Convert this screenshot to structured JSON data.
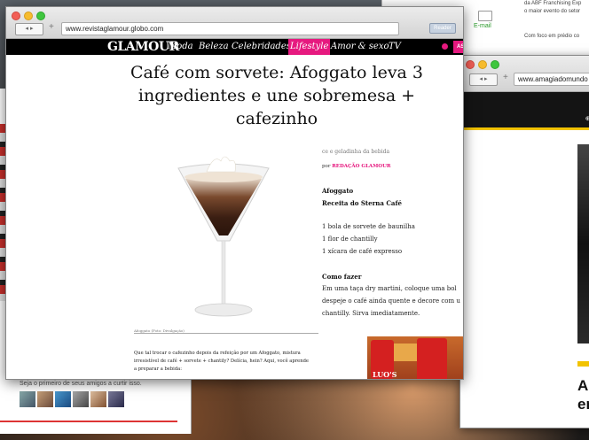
{
  "background_windows": {
    "top_right": {
      "lines": [
        "da ABF Franchising Exp",
        "o maior evento do setor",
        "Com foco em prédio co"
      ],
      "email_label": "E-mail"
    },
    "left": {
      "facebook_text": "Seja o primeiro de seus amigos a curtir isso."
    },
    "right": {
      "url": "www.amagiadomundo",
      "menu_text": "⊕ v",
      "headline_line1": "Ap",
      "headline_line2": "en"
    }
  },
  "main_window": {
    "url": "www.revistaglamour.globo.com",
    "nav_back_forward": "◂ ▸",
    "new_tab": "+",
    "reader_button": "Reader",
    "logo": "GLAMOUR",
    "nav": [
      {
        "label": "Moda",
        "active": false
      },
      {
        "label": "Beleza",
        "active": false
      },
      {
        "label": "Celebridades",
        "active": false
      },
      {
        "label": "Lifestyle",
        "active": true
      },
      {
        "label": "Amor & sexo",
        "active": false
      },
      {
        "label": "TV",
        "active": false
      }
    ],
    "subscribe_label": "ASSINE",
    "accent_color": "#e6197f",
    "article": {
      "title": "Café com sorvete: Afoggato leva 3 ingredientes e une sobremesa + cafezinho",
      "photo_credit": "Afoggato (Foto: Divulgação)",
      "tagline": "ce e geladinha da bebida",
      "byline_prefix": "por",
      "byline_author": "REDAÇÃO GLAMOUR",
      "recipe_name": "Afoggato",
      "recipe_source": "Receita do Sterna Café",
      "ingredients": [
        "1 bola de sorvete de baunilha",
        "1 flor de chantilly",
        "1 xícara de café expresso"
      ],
      "howto_heading": "Como fazer",
      "howto_lines": [
        "Em uma taça dry martini, coloque uma bol",
        "despeje o café ainda quente e decore com u",
        "chantilly. Sirva imediatamente."
      ],
      "intro": "Que tal trocar o cafezinho depois da refeição por um Afoggato, mistura irresistível de café + sorvete + chantily? Delícia, hein? Aqui, você aprende a preparar a bebida:"
    },
    "ad": {
      "brand": "LUO'S"
    }
  }
}
